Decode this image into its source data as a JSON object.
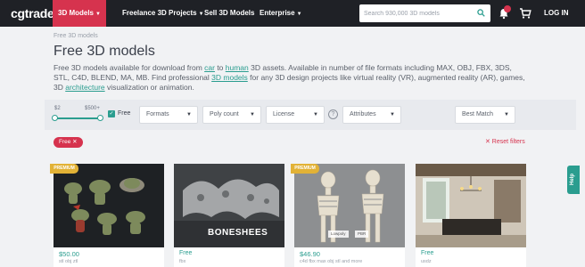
{
  "brand": "cgtrader",
  "nav": [
    {
      "label": "3D Models",
      "caret": "▼"
    },
    {
      "label": "Freelance 3D Projects",
      "caret": "▼"
    },
    {
      "label": "Sell 3D Models"
    },
    {
      "label": "Enterprise",
      "caret": "▼"
    }
  ],
  "search": {
    "placeholder": "Search 930,000 3D models",
    "value": ""
  },
  "header_icons": {
    "notifications": "bell-icon",
    "cart": "cart-icon"
  },
  "login": "LOG IN",
  "breadcrumb": "Free 3D models",
  "title": "Free 3D models",
  "description": {
    "p1": "Free 3D models available for download from ",
    "l1": "car",
    "p2": " to ",
    "l2": "human",
    "p3": " 3D assets. Available in number of file formats including MAX, OBJ, FBX, 3DS, STL, C4D, BLEND, MA, MB. Find professional ",
    "l3": "3D models",
    "p4": " for any 3D design projects like virtual reality (VR), augmented reality (AR), games, 3D ",
    "l4": "architecture",
    "p5": " visualization or animation."
  },
  "filters": {
    "price_min": "$2",
    "price_max": "$500+",
    "free_label": "Free",
    "free_checked": true,
    "formats": "Formats",
    "poly_count": "Poly count",
    "license": "License",
    "help": "?",
    "attributes": "Attributes",
    "sort": "Best Match",
    "caret": "▼"
  },
  "active_chip": "Free ✕",
  "reset": "✕ Reset filters",
  "colors": {
    "accent": "#d6334e",
    "teal": "#2a9d8f",
    "premium": "#e2b236",
    "nav_bg": "#1f2126"
  },
  "cards": [
    {
      "badge": "PREMIUM",
      "price": "$50.00",
      "formats": "stl obj ztl"
    },
    {
      "license": "Free",
      "formats": "fbx",
      "overlay": "BONESHEES"
    },
    {
      "badge": "PREMIUM",
      "price": "$46.90",
      "formats": "c4d fbx max obj stl and more",
      "tags": [
        "Lowpoly",
        "PBR"
      ]
    },
    {
      "license": "Free",
      "formats": "usdz"
    }
  ],
  "help_tab": "Help"
}
